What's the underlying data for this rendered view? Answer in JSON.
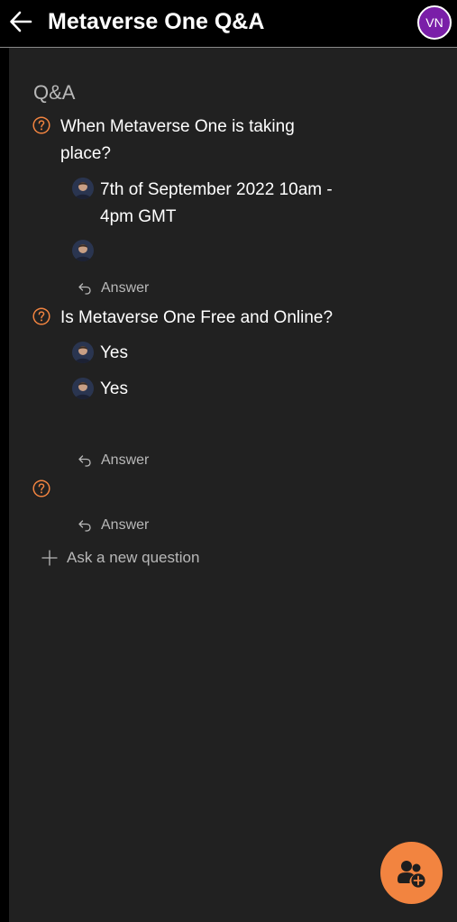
{
  "header": {
    "title": "Metaverse One Q&A",
    "avatar_initials": "VN"
  },
  "section": {
    "title": "Q&A"
  },
  "questions": [
    {
      "text_lines": [
        "When Metaverse One is taking",
        "place?"
      ],
      "answers": [
        {
          "text_lines": [
            "7th of September 2022 10am -",
            "4pm GMT"
          ]
        },
        {
          "text_lines": [
            ""
          ]
        }
      ],
      "answer_label": "Answer"
    },
    {
      "text_lines": [
        "Is Metaverse One Free and Online?"
      ],
      "answers": [
        {
          "text_lines": [
            "Yes"
          ]
        },
        {
          "text_lines": [
            "Yes"
          ]
        }
      ],
      "answer_label": "Answer"
    },
    {
      "text_lines": [
        ""
      ],
      "answers": [],
      "answer_label": "Answer"
    }
  ],
  "ask_new_label": "Ask a new question",
  "colors": {
    "accent": "#f28440",
    "avatar_bg": "#7a1fa8",
    "panel_bg": "#212121",
    "muted_text": "#b8b8b8"
  },
  "icons": {
    "back": "arrow-left-icon",
    "question": "question-circle-icon",
    "answer": "reply-icon",
    "add": "plus-icon",
    "fab": "people-add-icon"
  }
}
